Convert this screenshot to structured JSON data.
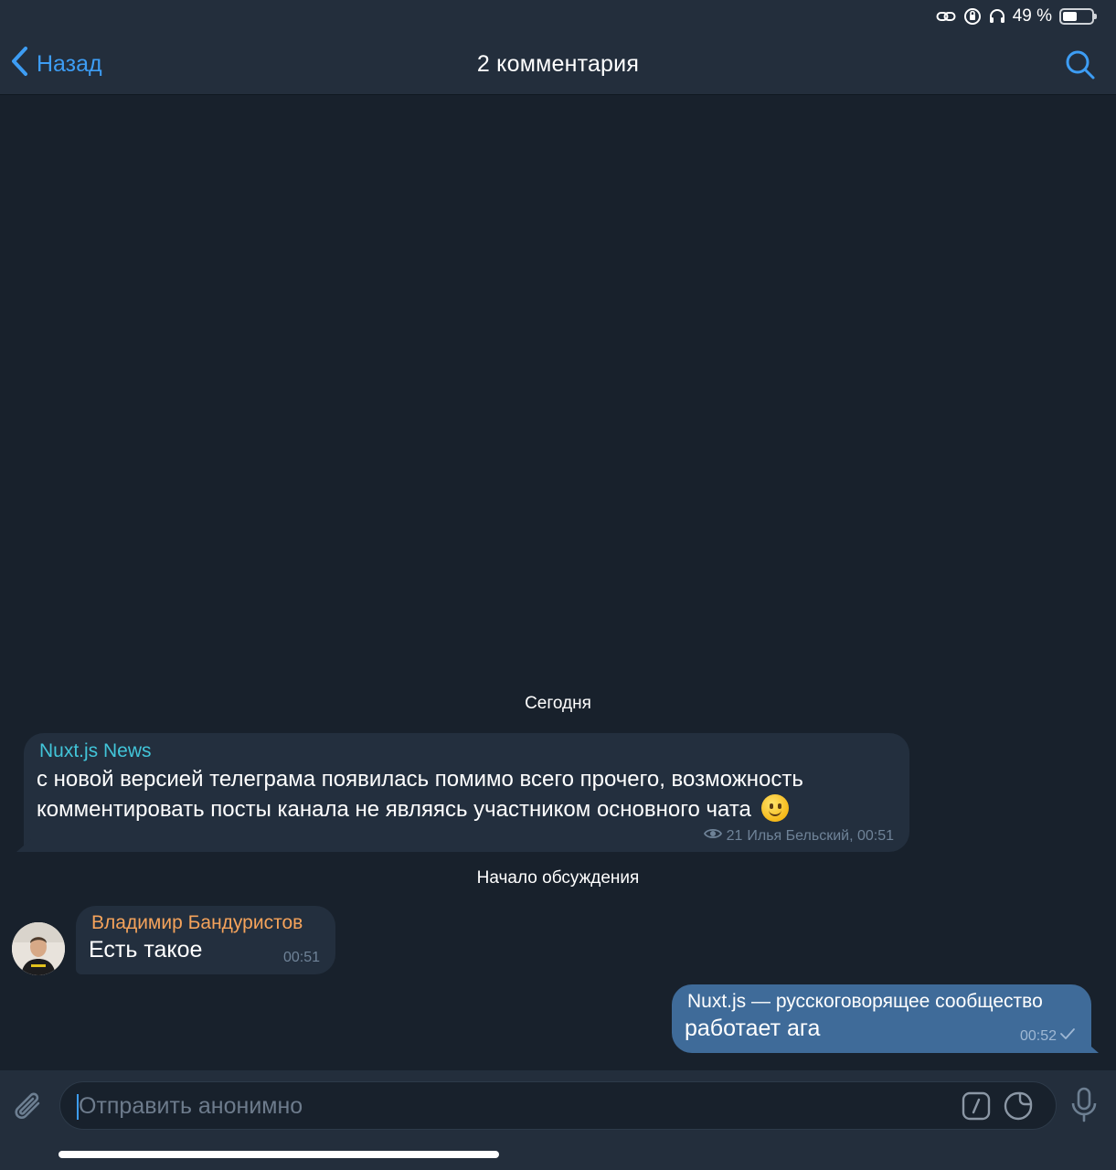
{
  "status_bar": {
    "battery_text": "49 %",
    "battery_level": 0.49
  },
  "header": {
    "back_label": "Назад",
    "title": "2 комментария"
  },
  "chat": {
    "date_label": "Сегодня",
    "post": {
      "author": "Nuxt.js News",
      "text": "с новой версией телеграма появилась помимо всего прочего, возможность комментировать посты канала не являясь участником основного чата",
      "views": "21",
      "signature_time": "Илья Бельский, 00:51"
    },
    "discussion_label": "Начало обсуждения",
    "incoming": {
      "author": "Владимир Бандуристов",
      "text": "Есть такое",
      "time": "00:51"
    },
    "outgoing": {
      "author": "Nuxt.js — русскоговорящее сообщество",
      "text": "работает ага",
      "time": "00:52"
    }
  },
  "input": {
    "placeholder": "Отправить анонимно"
  },
  "colors": {
    "accent": "#3d9df4",
    "background": "#18212c",
    "panel": "#232e3c",
    "bubble_in": "#232f3e",
    "bubble_out": "#3f6b99",
    "channel_name": "#42c5d9",
    "user_name": "#f5a35b"
  },
  "icons": [
    "link-icon",
    "orientation-lock-icon",
    "headphones-icon",
    "battery-icon",
    "back-chevron-icon",
    "search-icon",
    "eye-icon",
    "check-icon",
    "attach-icon",
    "bot-command-icon",
    "sticker-icon",
    "mic-icon"
  ]
}
